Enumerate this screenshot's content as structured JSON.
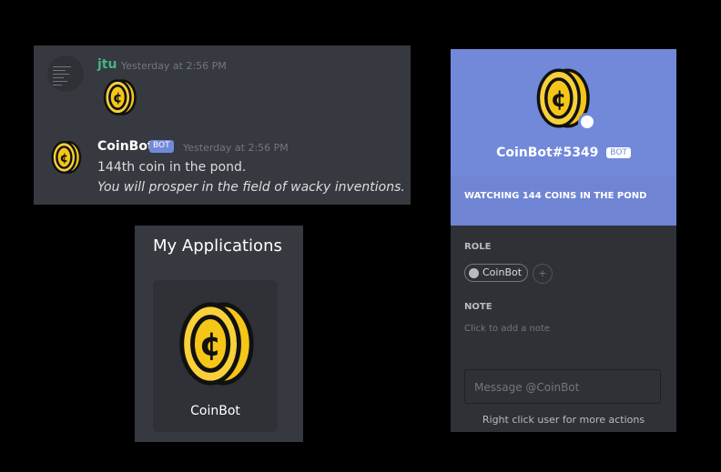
{
  "chat": {
    "messages": [
      {
        "author": "jtu",
        "author_color": "#43b581",
        "timestamp": "Yesterday at 2:56 PM",
        "lines": []
      },
      {
        "author": "CoinBot",
        "author_color": "#ffffff",
        "bot_tag": "BOT",
        "timestamp": "Yesterday at 2:56 PM",
        "lines": [
          "144th coin in the pond.",
          "You will prosper in the field of wacky inventions."
        ]
      }
    ]
  },
  "apps": {
    "title": "My Applications",
    "items": [
      {
        "name": "CoinBot",
        "icon": "coin-icon"
      }
    ]
  },
  "profile": {
    "username": "CoinBot#5349",
    "bot_tag": "BOT",
    "status": "WATCHING 144 COINS IN THE POND",
    "role_heading": "ROLE",
    "role": "CoinBot",
    "note_heading": "NOTE",
    "note_placeholder": "Click to add a note",
    "message_placeholder": "Message @CoinBot",
    "hint": "Right click user for more actions",
    "accent": "#7289da"
  }
}
